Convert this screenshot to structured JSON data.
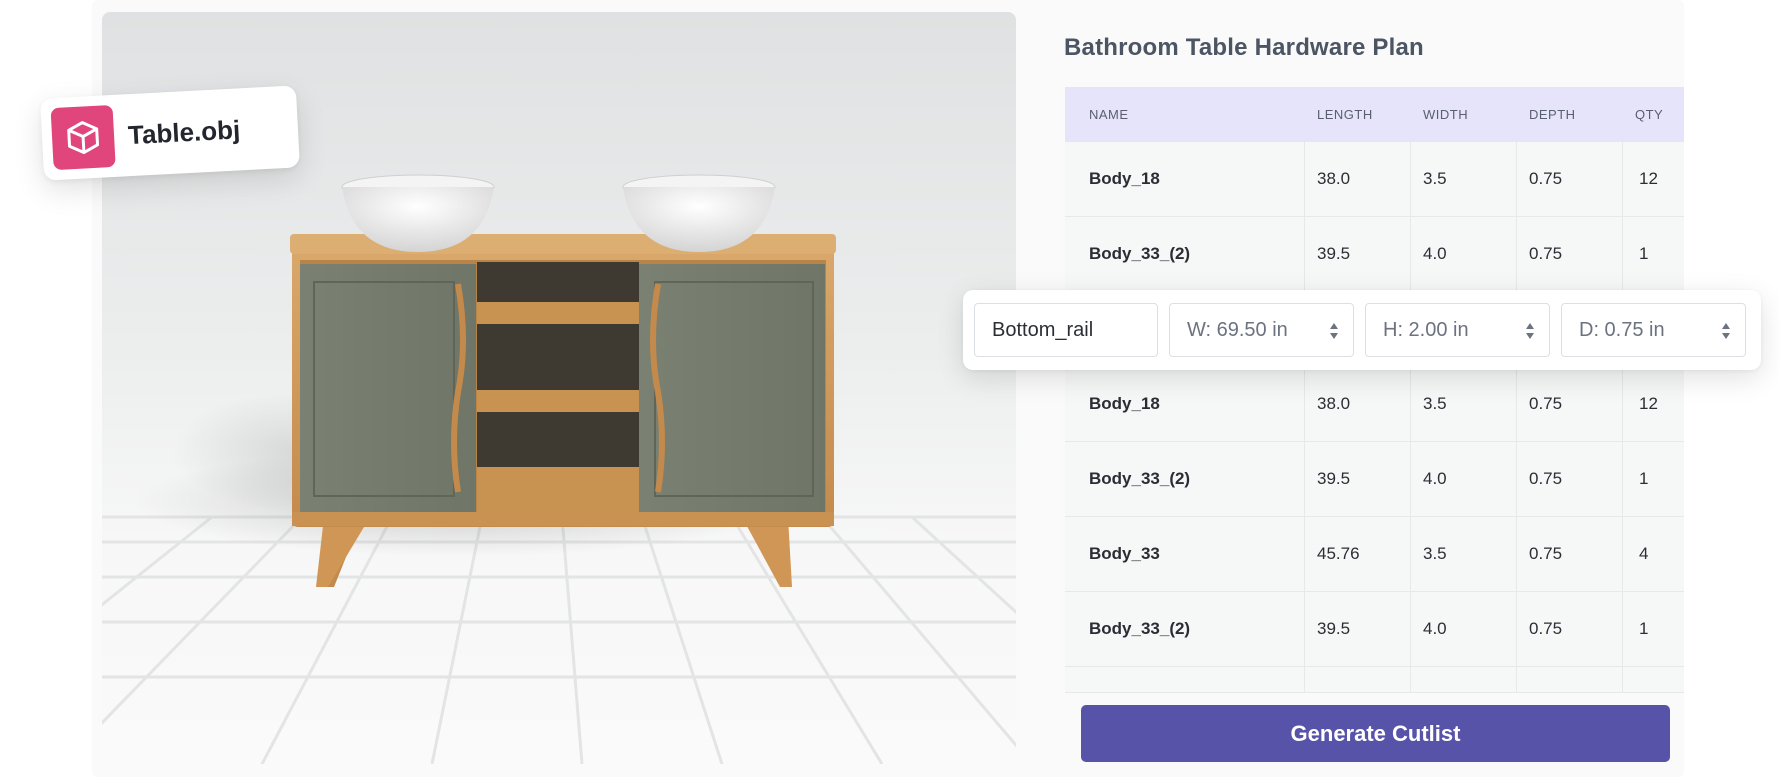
{
  "file_badge": {
    "filename": "Table.obj",
    "icon": "cube-icon"
  },
  "panel": {
    "title": "Bathroom Table Hardware Plan",
    "columns": [
      "NAME",
      "LENGTH",
      "WIDTH",
      "DEPTH",
      "QTY"
    ],
    "rows": [
      {
        "name": "Body_18",
        "length": "38.0",
        "width": "3.5",
        "depth": "0.75",
        "qty": "12"
      },
      {
        "name": "Body_33_(2)",
        "length": "39.5",
        "width": "4.0",
        "depth": "0.75",
        "qty": "1"
      },
      {
        "name": "Body_18",
        "length": "38.0",
        "width": "3.5",
        "depth": "0.75",
        "qty": "12"
      },
      {
        "name": "Body_33_(2)",
        "length": "39.5",
        "width": "4.0",
        "depth": "0.75",
        "qty": "1"
      },
      {
        "name": "Body_33",
        "length": "45.76",
        "width": "3.5",
        "depth": "0.75",
        "qty": "4"
      },
      {
        "name": "Body_33_(2)",
        "length": "39.5",
        "width": "4.0",
        "depth": "0.75",
        "qty": "1"
      }
    ],
    "generate_label": "Generate Cutlist"
  },
  "editor": {
    "part_name": "Bottom_rail",
    "width": "W: 69.50 in",
    "height": "H: 2.00 in",
    "depth": "D: 0.75 in"
  },
  "colors": {
    "accent": "#5753a8",
    "badge": "#e0457b",
    "header_bg": "#e5e4fb"
  }
}
